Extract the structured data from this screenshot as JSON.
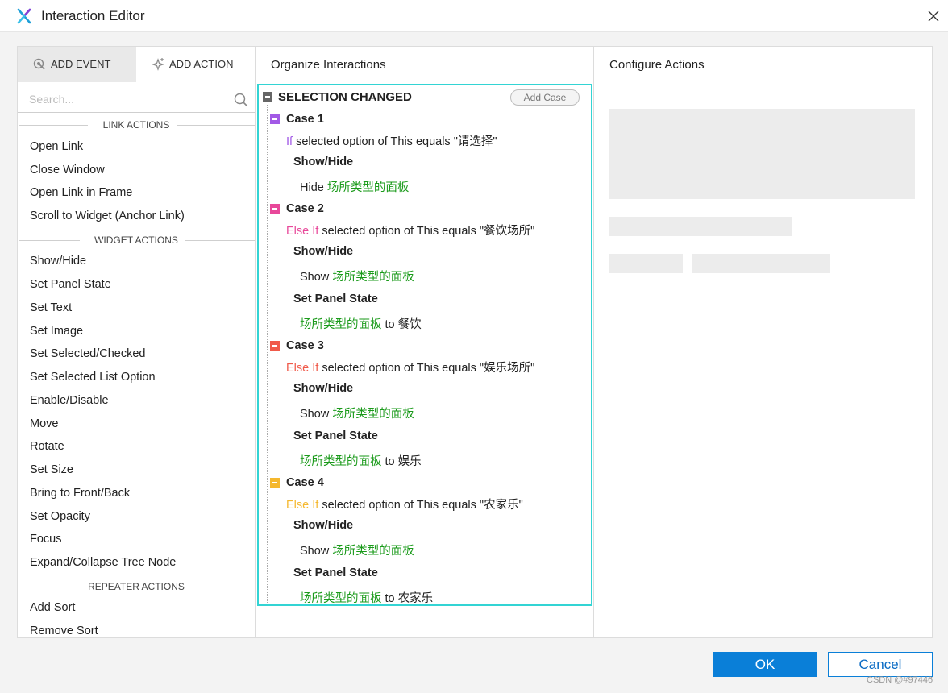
{
  "window": {
    "title": "Interaction Editor",
    "close_icon": "close-icon"
  },
  "left": {
    "tabs": [
      {
        "label": "ADD EVENT",
        "icon": "add-event-icon",
        "active": true
      },
      {
        "label": "ADD ACTION",
        "icon": "add-action-icon",
        "active": false
      }
    ],
    "search": {
      "placeholder": "Search...",
      "value": ""
    },
    "sections": [
      {
        "title": "LINK ACTIONS"
      },
      {
        "title": "WIDGET ACTIONS"
      },
      {
        "title": "REPEATER ACTIONS"
      }
    ],
    "link_actions": [
      "Open Link",
      "Close Window",
      "Open Link in Frame",
      "Scroll to Widget (Anchor Link)"
    ],
    "widget_actions": [
      "Show/Hide",
      "Set Panel State",
      "Set Text",
      "Set Image",
      "Set Selected/Checked",
      "Set Selected List Option",
      "Enable/Disable",
      "Move",
      "Rotate",
      "Set Size",
      "Bring to Front/Back",
      "Set Opacity",
      "Focus",
      "Expand/Collapse Tree Node"
    ],
    "repeater_actions": [
      "Add Sort",
      "Remove Sort"
    ]
  },
  "middle": {
    "title": "Organize Interactions",
    "event": "SELECTION CHANGED",
    "add_case_label": "Add Case",
    "cases": [
      {
        "title": "Case 1",
        "color": "#a259e6",
        "keyword": "If",
        "keyword_color": "#a259e6",
        "condition": " selected option of This equals \"请选择\"",
        "actions": [
          {
            "name": "Show/Hide",
            "prefix": "Hide ",
            "target": "场所类型的面板",
            "suffix": ""
          }
        ]
      },
      {
        "title": "Case 2",
        "color": "#e8489a",
        "keyword": "Else If",
        "keyword_color": "#e8489a",
        "condition": " selected option of This equals \"餐饮场所\"",
        "actions": [
          {
            "name": "Show/Hide",
            "prefix": "Show ",
            "target": "场所类型的面板",
            "suffix": ""
          },
          {
            "name": "Set Panel State",
            "prefix": "",
            "target": "场所类型的面板",
            "suffix": " to 餐饮"
          }
        ]
      },
      {
        "title": "Case 3",
        "color": "#f05a4a",
        "keyword": "Else If",
        "keyword_color": "#f05a4a",
        "condition": " selected option of This equals \"娱乐场所\"",
        "actions": [
          {
            "name": "Show/Hide",
            "prefix": "Show ",
            "target": "场所类型的面板",
            "suffix": ""
          },
          {
            "name": "Set Panel State",
            "prefix": "",
            "target": "场所类型的面板",
            "suffix": " to 娱乐"
          }
        ]
      },
      {
        "title": "Case 4",
        "color": "#f5b82e",
        "keyword": "Else If",
        "keyword_color": "#f5b82e",
        "condition": " selected option of This equals \"农家乐\"",
        "actions": [
          {
            "name": "Show/Hide",
            "prefix": "Show ",
            "target": "场所类型的面板",
            "suffix": ""
          },
          {
            "name": "Set Panel State",
            "prefix": "",
            "target": "场所类型的面板",
            "suffix": " to 农家乐"
          }
        ]
      }
    ]
  },
  "right": {
    "title": "Configure Actions"
  },
  "footer": {
    "ok_label": "OK",
    "cancel_label": "Cancel",
    "watermark": "CSDN @#97446"
  },
  "colors": {
    "accent": "#0a7fd8",
    "selection_border": "#33d4d4",
    "target_green": "#1a9a1a"
  }
}
